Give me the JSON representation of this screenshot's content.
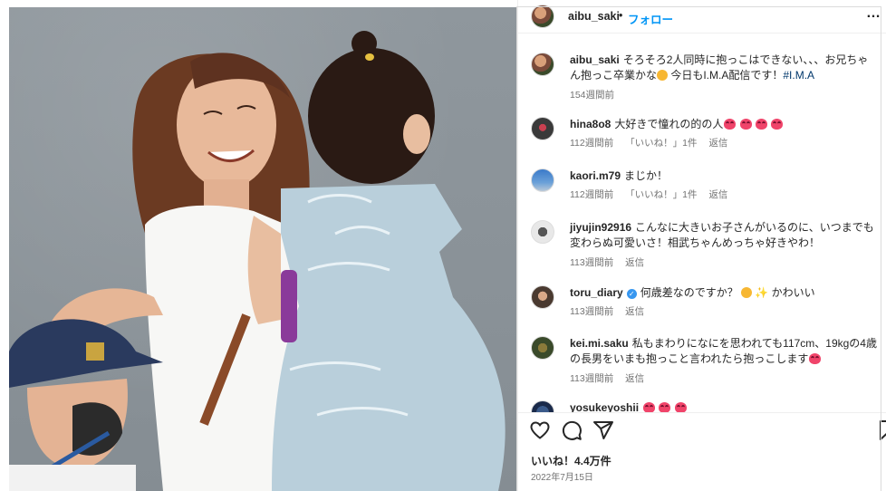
{
  "header": {
    "username": "aibu_saki",
    "separator": "•",
    "follow_label": "フォロー",
    "more_label": "…"
  },
  "comments": [
    {
      "username": "aibu_saki",
      "text": "そろそろ2人同時に抱っこはできない、、、お兄ちゃん抱っこ卒業かな",
      "text_after_emoji": " 今日もI.M.A配信です！",
      "hashtag": "#I.M.A",
      "time": "154週間前"
    },
    {
      "username": "hina8o8",
      "text": "大好きで憧れの的の人",
      "time": "112週間前",
      "likes": "「いいね！」1件",
      "reply": "返信",
      "hearts": 4
    },
    {
      "username": "kaori.m79",
      "text": "まじか！",
      "time": "112週間前",
      "likes": "「いいね！」1件",
      "reply": "返信"
    },
    {
      "username": "jiyujin92916",
      "text": "こんなに大きいお子さんがいるのに、いつまでも変わらぬ可愛いさ！相武ちゃんめっちゃ好きやわ！",
      "time": "113週間前",
      "reply": "返信"
    },
    {
      "username": "toru_diary",
      "verified": true,
      "text": "何歳差なのですか？",
      "text_after_emoji": " かわいい",
      "time": "113週間前",
      "reply": "返信"
    },
    {
      "username": "kei.mi.saku",
      "text": "私もまわりになにを思われても117cm、19kgの4歳の長男をいまも抱っこと言われたら抱っこします",
      "time": "113週間前",
      "reply": "返信"
    },
    {
      "username": "yosukeyoshii",
      "text": ""
    }
  ],
  "footer": {
    "likes": "いいね！4.4万件",
    "date": "2022年7月15日"
  },
  "icons": {
    "like": "heart-icon",
    "comment": "comment-icon",
    "share": "share-icon"
  },
  "colors": {
    "follow": "#0095f6",
    "text": "#262626",
    "muted": "#737373",
    "hashtag": "#00376b",
    "verified": "#3897f0"
  }
}
